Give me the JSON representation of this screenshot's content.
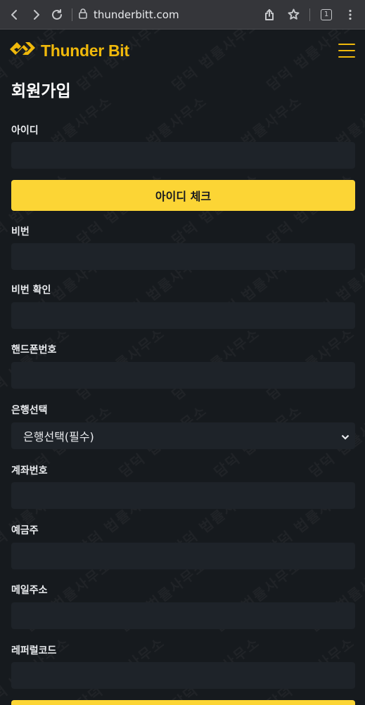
{
  "browser": {
    "url": "thunderbitt.com",
    "tab_count": "1"
  },
  "header": {
    "logo_text": "Thunder Bit"
  },
  "watermark": {
    "text": "담덕 법률사무소"
  },
  "form": {
    "title": "회원가입",
    "id_label": "아이디",
    "id_value": "",
    "id_check_button": "아이디 체크",
    "password_label": "비번",
    "password_value": "",
    "password_confirm_label": "비번 확인",
    "password_confirm_value": "",
    "phone_label": "핸드폰번호",
    "phone_value": "",
    "bank_label": "은행선택",
    "bank_selected": "은행선택(필수)",
    "account_label": "계좌번호",
    "account_value": "",
    "holder_label": "예금주",
    "holder_value": "",
    "email_label": "메일주소",
    "email_value": "",
    "referral_label": "레퍼럴코드",
    "referral_value": ""
  },
  "colors": {
    "accent": "#fcd535",
    "background": "#161a1e",
    "input_background": "#1e2329"
  }
}
